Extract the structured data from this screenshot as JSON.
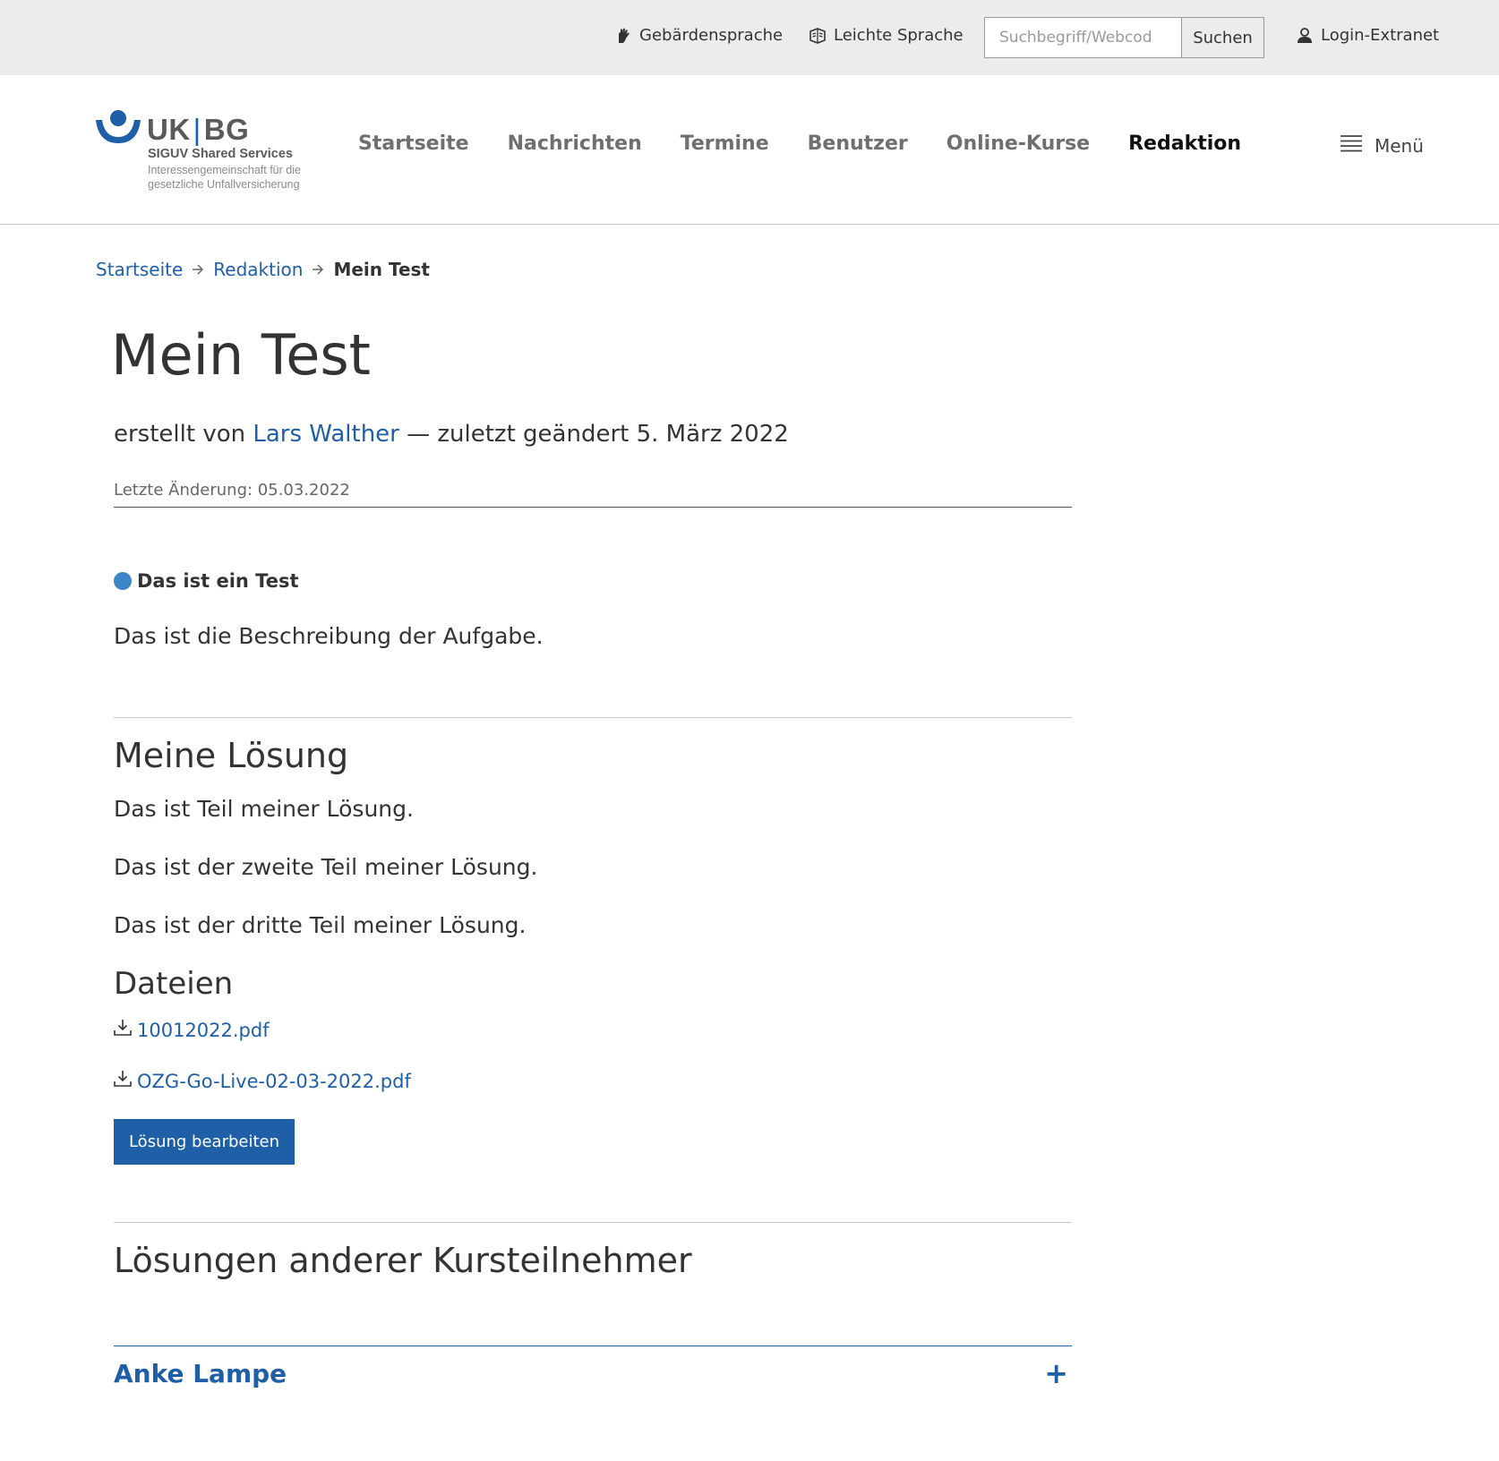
{
  "utility": {
    "sign_language": "Gebärdensprache",
    "easy_language": "Leichte Sprache",
    "search_placeholder": "Suchbegriff/Webcod",
    "search_button": "Suchen",
    "login": "Login-Extranet"
  },
  "logo": {
    "uk": "UK",
    "bg": "BG",
    "line1": "SIGUV Shared Services",
    "line2": "Interessengemeinschaft für die",
    "line3": "gesetzliche Unfallversicherung"
  },
  "nav": {
    "items": [
      "Startseite",
      "Nachrichten",
      "Termine",
      "Benutzer",
      "Online-Kurse",
      "Redaktion"
    ],
    "active": "Redaktion",
    "menu_label": "Menü"
  },
  "breadcrumb": {
    "home": "Startseite",
    "section": "Redaktion",
    "current": "Mein Test"
  },
  "page": {
    "title": "Mein Test",
    "byline_prefix": "erstellt von",
    "author": "Lars Walther",
    "byline_suffix": "— zuletzt geändert 5. März 2022",
    "last_modified": "Letzte Änderung: 05.03.2022"
  },
  "task": {
    "title": "Das ist ein Test",
    "description": "Das ist die Beschreibung der Aufgabe.",
    "status_color": "#3d85c6"
  },
  "solution": {
    "heading": "Meine Lösung",
    "paragraphs": [
      "Das ist Teil meiner Lösung.",
      "Das ist der zweite Teil meiner Lösung.",
      "Das ist der dritte Teil meiner Lösung."
    ],
    "files_heading": "Dateien",
    "files": [
      "10012022.pdf",
      "OZG-Go-Live-02-03-2022.pdf"
    ],
    "edit_button": "Lösung bearbeiten"
  },
  "others": {
    "heading": "Lösungen anderer Kursteilnehmer",
    "participants": [
      {
        "name": "Anke Lampe",
        "toggle": "+"
      }
    ]
  },
  "colors": {
    "accent": "#1f5fa8",
    "topbar_bg": "#ececec"
  }
}
